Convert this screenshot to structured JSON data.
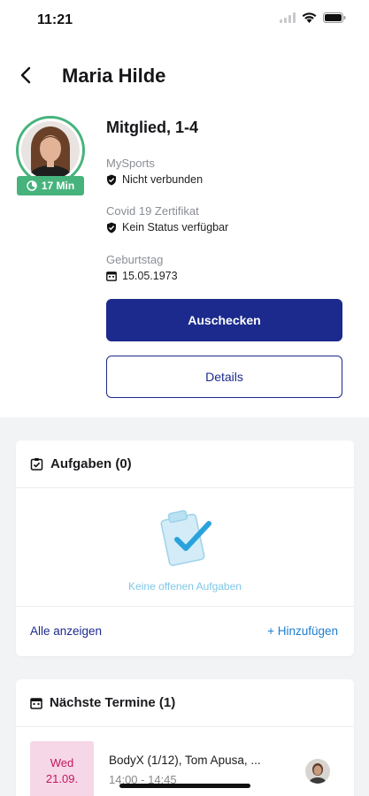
{
  "status": {
    "time": "11:21"
  },
  "header": {
    "title": "Maria Hilde"
  },
  "profile": {
    "timer_label": "17 Min",
    "membership": "Mitglied, 1-4",
    "mysports_label": "MySports",
    "mysports_value": "Nicht verbunden",
    "covid_label": "Covid 19 Zertifikat",
    "covid_value": "Kein Status verfügbar",
    "birthday_label": "Geburtstag",
    "birthday_value": "15.05.1973"
  },
  "actions": {
    "checkout": "Auschecken",
    "details": "Details"
  },
  "tasks": {
    "title": "Aufgaben (0)",
    "empty_text": "Keine offenen Aufgaben",
    "show_all": "Alle anzeigen",
    "add": "+ Hinzufügen"
  },
  "appointments": {
    "title": "Nächste Termine (1)",
    "items": [
      {
        "day": "Wed",
        "date": "21.09.",
        "title": "BodyX (1/12), Tom Apusa, ...",
        "time": "14:00 - 14:45"
      }
    ]
  },
  "colors": {
    "primary": "#1b2a8c",
    "accent_green": "#47b37c",
    "link_blue": "#1b7fd0",
    "date_bg": "#f6d7e7",
    "date_text": "#c2185b"
  }
}
